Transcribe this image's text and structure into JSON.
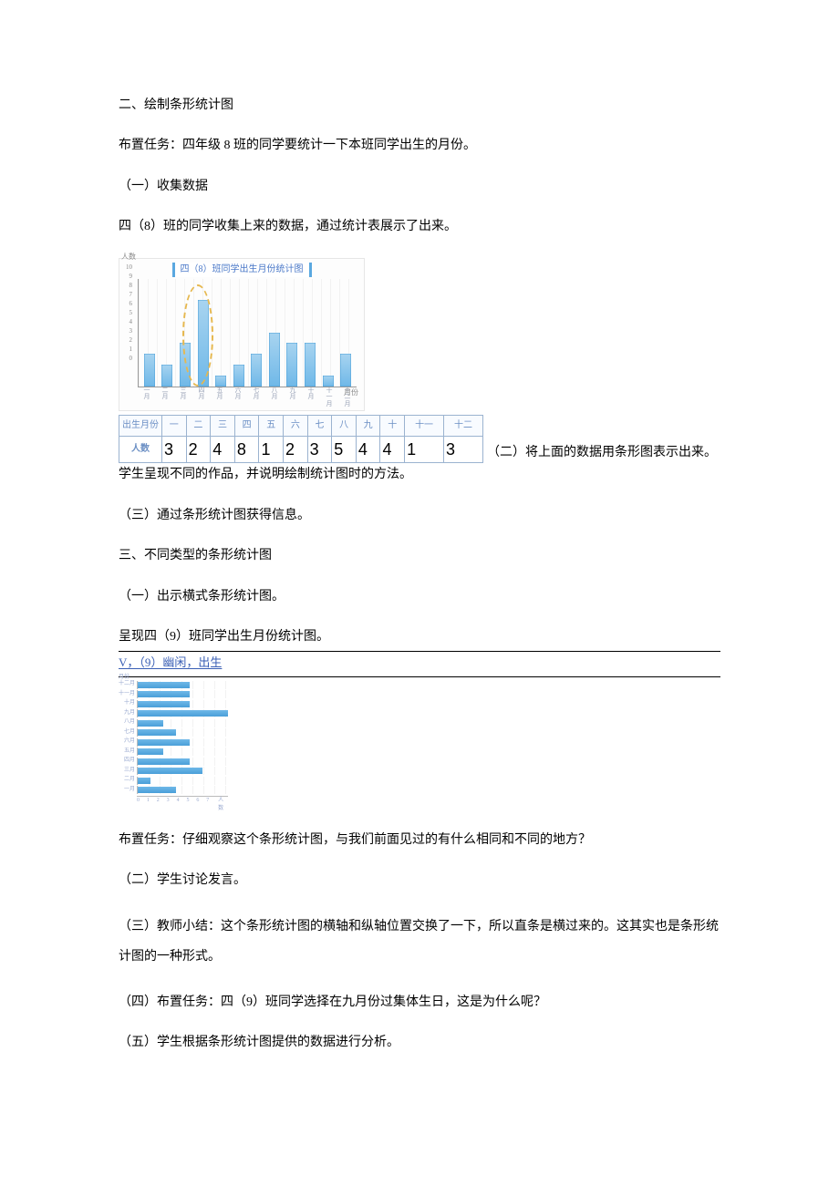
{
  "section2_heading": "二、绘制条形统计图",
  "task1": "布置任务：四年级 8 班的同学要统计一下本班同学出生的月份。",
  "sub1_heading": "（一）收集数据",
  "sub1_text": "四（8）班的同学收集上来的数据，通过统计表展示了出来。",
  "chart_data": [
    {
      "id": "class8_births",
      "type": "bar",
      "title": "四（8）班同学出生月份统计图",
      "xlabel": "月份",
      "ylabel": "人数",
      "ylim": [
        0,
        10
      ],
      "categories": [
        "一月",
        "二月",
        "三月",
        "四月",
        "五月",
        "六月",
        "七月",
        "八月",
        "九月",
        "十月",
        "十一月",
        "十二月"
      ],
      "values": [
        3,
        2,
        4,
        8,
        1,
        2,
        3,
        5,
        4,
        4,
        1,
        3
      ],
      "highlight_indices": [
        2,
        3
      ]
    },
    {
      "id": "class9_births",
      "type": "bar_horizontal",
      "title": "四（9）班同学出生月份统计图",
      "xlabel": "人数",
      "ylabel": "月份",
      "xlim": [
        0,
        7
      ],
      "categories": [
        "十二月",
        "十一月",
        "十月",
        "九月",
        "八月",
        "七月",
        "六月",
        "五月",
        "四月",
        "三月",
        "二月",
        "一月"
      ],
      "values": [
        4,
        4,
        4,
        7,
        2,
        3,
        4,
        2,
        4,
        5,
        1,
        3
      ]
    }
  ],
  "table": {
    "row1_label": "出生月份",
    "row2_label": "人数",
    "headers": [
      "一",
      "二",
      "三",
      "四",
      "五",
      "六",
      "七",
      "八",
      "九",
      "十",
      "十一",
      "十二"
    ],
    "values": [
      "3",
      "2",
      "4",
      "8",
      "1",
      "2",
      "3",
      "5",
      "4",
      "4",
      "1",
      "3"
    ]
  },
  "after_table_text": "（二）将上面的数据用条形图表示出来。",
  "student_work_text": "学生呈现不同的作品，并说明绘制统计图时的方法。",
  "sub3_heading": "（三）通过条形统计图获得信息。",
  "section3_heading": "三、不同类型的条形统计图",
  "sub3_1_heading": "（一）出示横式条形统计图。",
  "show_text": "呈现四（9）班同学出生月份统计图。",
  "underline_text": "V，（9）幽闲，出生",
  "task2": "布置任务：仔细观察这个条形统计图，与我们前面见过的有什么相同和不同的地方？",
  "sub3_2": "（二）学生讨论发言。",
  "sub3_3": "（三）教师小结：这个条形统计图的横轴和纵轴位置交换了一下，所以直条是横过来的。这其实也是条形统计图的一种形式。",
  "sub3_4": "（四）布置任务：四（9）班同学选择在九月份过集体生日，这是为什么呢？",
  "sub3_5": "（五）学生根据条形统计图提供的数据进行分析。",
  "yTicks": [
    "10",
    "9",
    "8",
    "7",
    "6",
    "5",
    "4",
    "3",
    "2",
    "1",
    "0"
  ],
  "xTicks2": [
    "0",
    "1",
    "2",
    "3",
    "4",
    "5",
    "6",
    "7"
  ],
  "xUnit2": "人数"
}
